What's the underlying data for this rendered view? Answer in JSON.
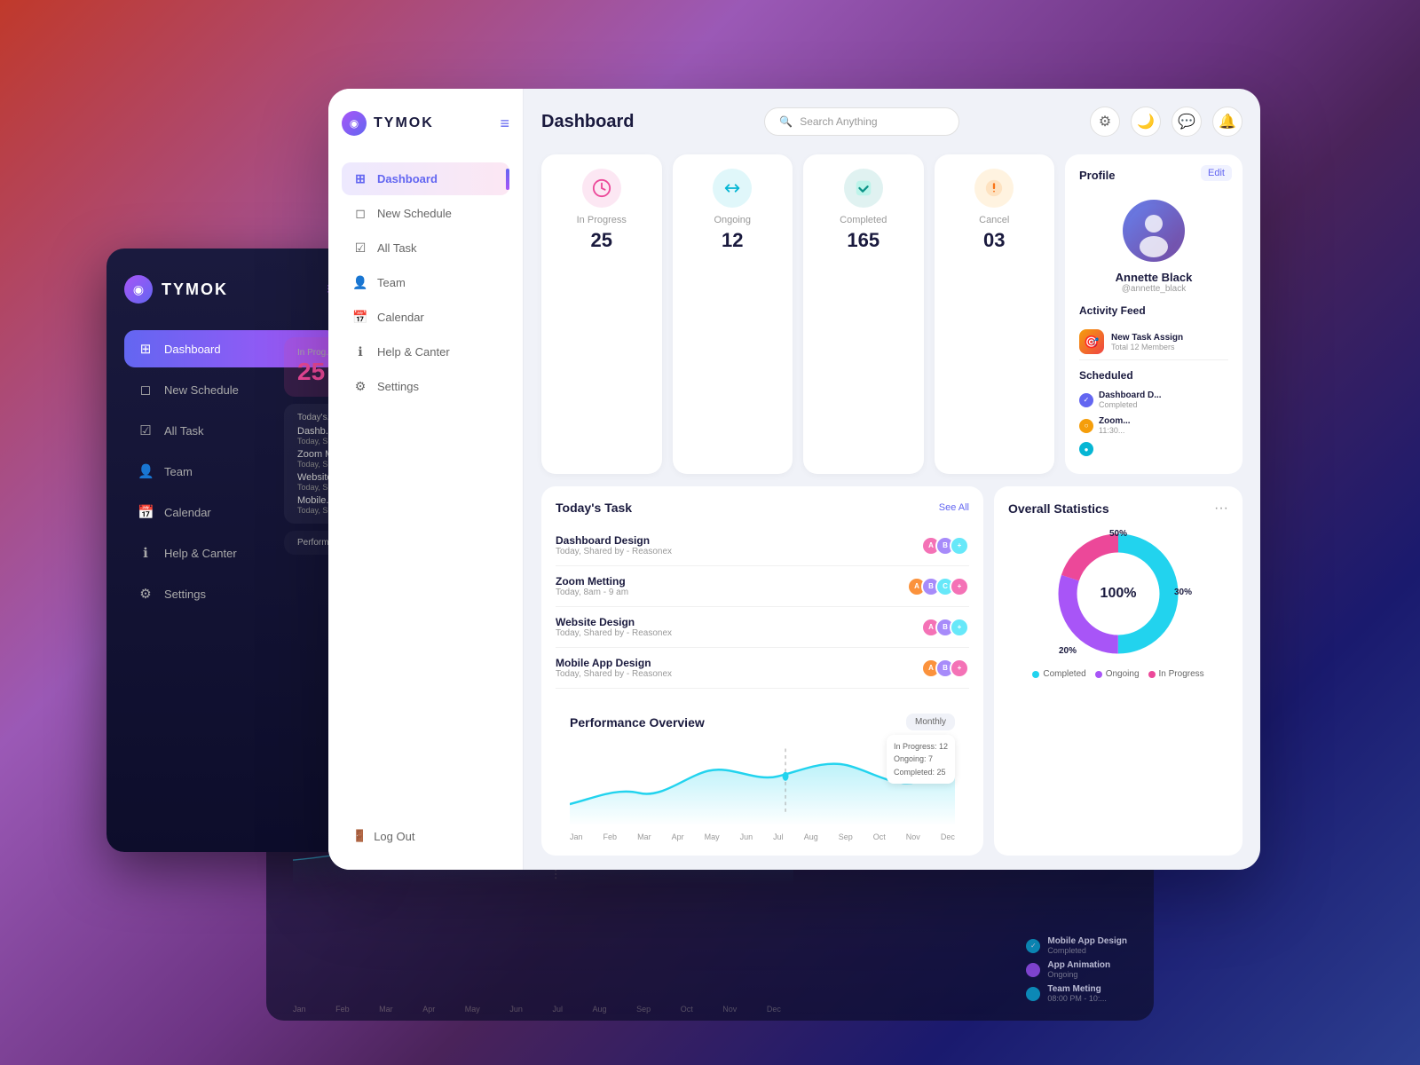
{
  "app": {
    "name": "TYMOK",
    "tagline": "Dashboard"
  },
  "sidebar": {
    "nav_items": [
      {
        "id": "dashboard",
        "label": "Dashboard",
        "icon": "⊞",
        "active": true
      },
      {
        "id": "new-schedule",
        "label": "New Schedule",
        "icon": "◻"
      },
      {
        "id": "all-task",
        "label": "All Task",
        "icon": "☑"
      },
      {
        "id": "team",
        "label": "Team",
        "icon": "👤"
      },
      {
        "id": "calendar",
        "label": "Calendar",
        "icon": "📅"
      },
      {
        "id": "help",
        "label": "Help & Canter",
        "icon": "ℹ"
      },
      {
        "id": "settings",
        "label": "Settings",
        "icon": "⚙"
      }
    ],
    "logout_label": "Log Out"
  },
  "header": {
    "title": "Dashboard",
    "search_placeholder": "Search Anything"
  },
  "stats": [
    {
      "id": "in-progress",
      "label": "In Progress",
      "value": "25",
      "icon": "⏰",
      "color": "pink"
    },
    {
      "id": "ongoing",
      "label": "Ongoing",
      "value": "12",
      "icon": "🔄",
      "color": "cyan"
    },
    {
      "id": "completed",
      "label": "Completed",
      "value": "165",
      "icon": "✅",
      "color": "teal"
    },
    {
      "id": "cancel",
      "label": "Cancel",
      "value": "03",
      "icon": "🔔",
      "color": "orange"
    }
  ],
  "tasks": {
    "title": "Today's Task",
    "see_all": "See All",
    "items": [
      {
        "name": "Dashboard Design",
        "date": "Today, Shared by - Reasonex",
        "avatars": [
          "#f472b6",
          "#a78bfa",
          "#67e8f9"
        ]
      },
      {
        "name": "Zoom Metting",
        "date": "Today, 8am - 9 am",
        "avatars": [
          "#fb923c",
          "#a78bfa",
          "#67e8f9",
          "#f472b6"
        ]
      },
      {
        "name": "Website Design",
        "date": "Today, Shared by - Reasonex",
        "avatars": [
          "#f472b6",
          "#a78bfa",
          "#67e8f9"
        ]
      },
      {
        "name": "Mobile App Design",
        "date": "Today, Shared by - Reasonex",
        "avatars": [
          "#fb923c",
          "#a78bfa",
          "#f472b6"
        ]
      }
    ]
  },
  "donut": {
    "title": "Overall Statistics",
    "center_label": "100%",
    "segments": [
      {
        "label": "Completed",
        "pct": 50,
        "color": "#22d3ee"
      },
      {
        "label": "Ongoing",
        "pct": 30,
        "color": "#a855f7"
      },
      {
        "label": "In Progress",
        "pct": 20,
        "color": "#ec4899"
      }
    ],
    "pct_labels": [
      {
        "text": "50%",
        "pos": "top"
      },
      {
        "text": "30%",
        "pos": "right"
      },
      {
        "text": "20%",
        "pos": "bottom-left"
      }
    ]
  },
  "profile": {
    "title": "Profile",
    "edit_label": "Edit",
    "name": "Annette Black",
    "handle": "@annette_black",
    "avatar_emoji": "🧔"
  },
  "activity_feed": {
    "title": "Activity Feed",
    "items": [
      {
        "text": "New Task Assign",
        "sub": "Total 12 Members",
        "icon": "🎯"
      }
    ]
  },
  "scheduled": {
    "title": "Scheduled",
    "items": [
      {
        "name": "Dashboard D...",
        "sub": "Completed",
        "color": "indigo"
      },
      {
        "name": "Zoom...",
        "sub": "11:30...",
        "color": "orange"
      },
      {
        "name": "",
        "sub": "",
        "color": "cyan"
      }
    ]
  },
  "performance": {
    "title": "Performance Overview",
    "filter": "Monthly",
    "legend": {
      "in_progress": "In Progress: 12",
      "ongoing": "Ongoing: 7",
      "completed": "Completed: 25"
    },
    "months": [
      "Jan",
      "Feb",
      "Mar",
      "Apr",
      "May",
      "Jun",
      "Jul",
      "Aug",
      "Sep",
      "Oct",
      "Nov",
      "Dec"
    ]
  },
  "dark_sidebar": {
    "in_progress_label": "In Prog...",
    "in_progress_value": "25"
  }
}
